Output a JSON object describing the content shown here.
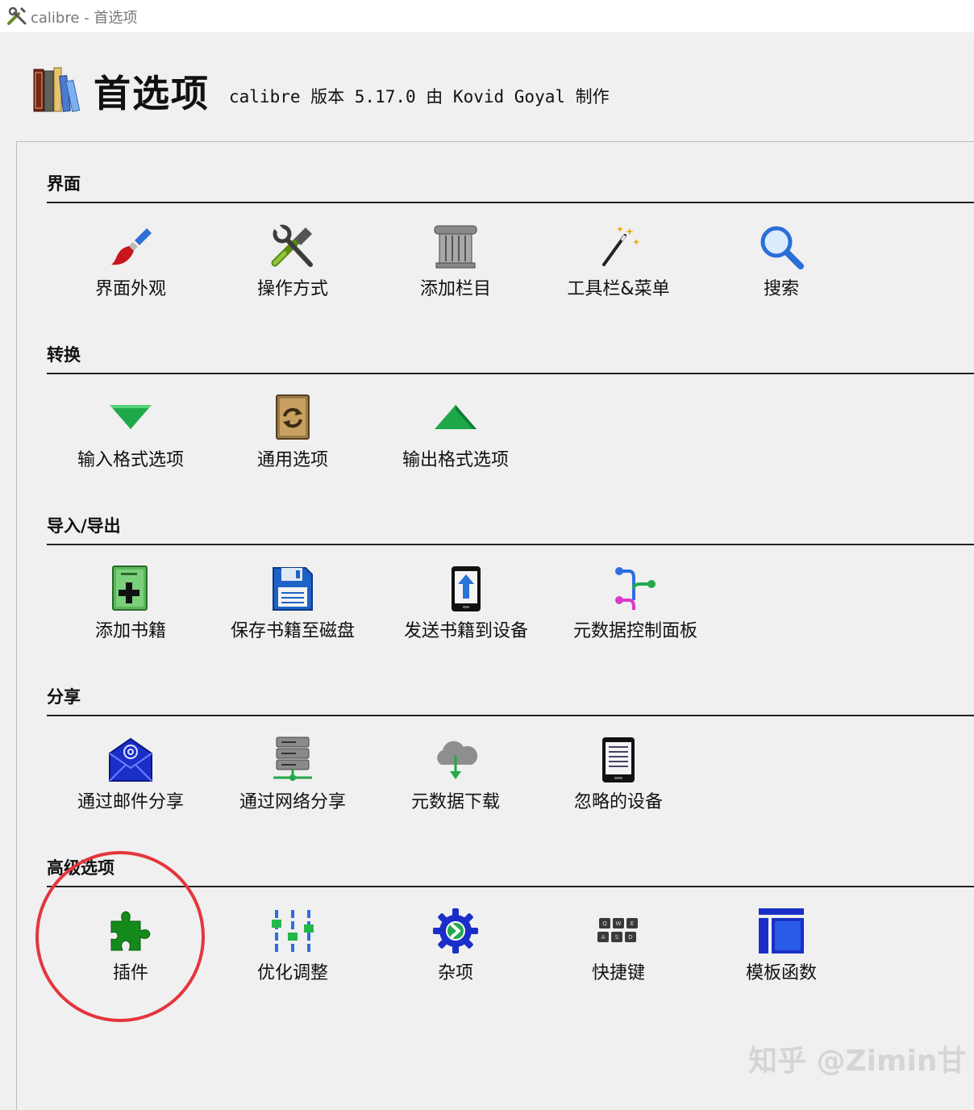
{
  "window": {
    "title": "calibre - 首选项"
  },
  "header": {
    "heading": "首选项",
    "subtitle": "calibre 版本 5.17.0 由 Kovid Goyal 制作"
  },
  "sections": [
    {
      "title": "界面",
      "items": [
        {
          "label": "界面外观",
          "icon": "brush-icon"
        },
        {
          "label": "操作方式",
          "icon": "tools-icon"
        },
        {
          "label": "添加栏目",
          "icon": "column-icon"
        },
        {
          "label": "工具栏&菜单",
          "icon": "magic-wand-icon"
        },
        {
          "label": "搜索",
          "icon": "search-icon"
        }
      ]
    },
    {
      "title": "转换",
      "items": [
        {
          "label": "输入格式选项",
          "icon": "arrow-down-icon"
        },
        {
          "label": "通用选项",
          "icon": "convert-book-icon"
        },
        {
          "label": "输出格式选项",
          "icon": "arrow-up-icon"
        }
      ]
    },
    {
      "title": "导入/导出",
      "items": [
        {
          "label": "添加书籍",
          "icon": "add-book-icon"
        },
        {
          "label": "保存书籍至磁盘",
          "icon": "floppy-disk-icon"
        },
        {
          "label": "发送书籍到设备",
          "icon": "send-device-icon"
        },
        {
          "label": "元数据控制面板",
          "icon": "metadata-graph-icon"
        }
      ]
    },
    {
      "title": "分享",
      "items": [
        {
          "label": "通过邮件分享",
          "icon": "mail-icon"
        },
        {
          "label": "通过网络分享",
          "icon": "server-icon"
        },
        {
          "label": "元数据下载",
          "icon": "cloud-download-icon"
        },
        {
          "label": "忽略的设备",
          "icon": "ereader-icon"
        }
      ]
    },
    {
      "title": "高级选项",
      "items": [
        {
          "label": "插件",
          "icon": "puzzle-icon"
        },
        {
          "label": "优化调整",
          "icon": "sliders-icon"
        },
        {
          "label": "杂项",
          "icon": "gear-icon"
        },
        {
          "label": "快捷键",
          "icon": "keyboard-icon"
        },
        {
          "label": "模板函数",
          "icon": "template-icon"
        }
      ]
    }
  ],
  "watermark": "知乎 @Zimin甘",
  "colors": {
    "highlight_circle": "#e4363d"
  }
}
